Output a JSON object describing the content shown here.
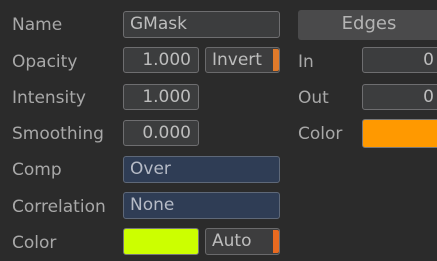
{
  "left": {
    "name_label": "Name",
    "name_value": "GMask",
    "opacity_label": "Opacity",
    "opacity_value": "1.000",
    "invert_label": "Invert",
    "intensity_label": "Intensity",
    "intensity_value": "1.000",
    "smoothing_label": "Smoothing",
    "smoothing_value": "0.000",
    "comp_label": "Comp",
    "comp_value": "Over",
    "correlation_label": "Correlation",
    "correlation_value": "None",
    "color_label": "Color",
    "color_swatch": "#ccff00",
    "auto_label": "Auto"
  },
  "edges": {
    "header": "Edges",
    "in_label": "In",
    "in_value": "0",
    "out_label": "Out",
    "out_value": "0",
    "color_label": "Color",
    "color_swatch": "#ff9900"
  },
  "colors": {
    "toggle_accent": "#e07a2a"
  }
}
